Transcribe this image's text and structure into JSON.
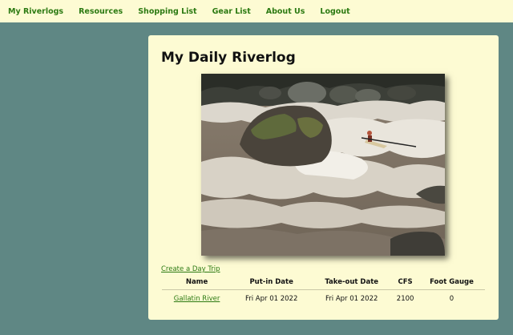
{
  "nav": {
    "items": [
      {
        "label": "My Riverlogs"
      },
      {
        "label": "Resources"
      },
      {
        "label": "Shopping List"
      },
      {
        "label": "Gear List"
      },
      {
        "label": "About Us"
      },
      {
        "label": "Logout"
      }
    ]
  },
  "colors": {
    "page_background": "#5f8784",
    "card_background": "#fdfbd3",
    "link_green": "#2c7a12"
  },
  "main": {
    "title": "My Daily Riverlog",
    "create_link": "Create a Day Trip",
    "table": {
      "headers": [
        "Name",
        "Put-in Date",
        "Take-out Date",
        "CFS",
        "Foot Gauge"
      ],
      "rows": [
        {
          "name": "Gallatin River",
          "put_in": "Fri Apr 01 2022",
          "take_out": "Fri Apr 01 2022",
          "cfs": "2100",
          "foot_gauge": "0"
        }
      ]
    }
  }
}
